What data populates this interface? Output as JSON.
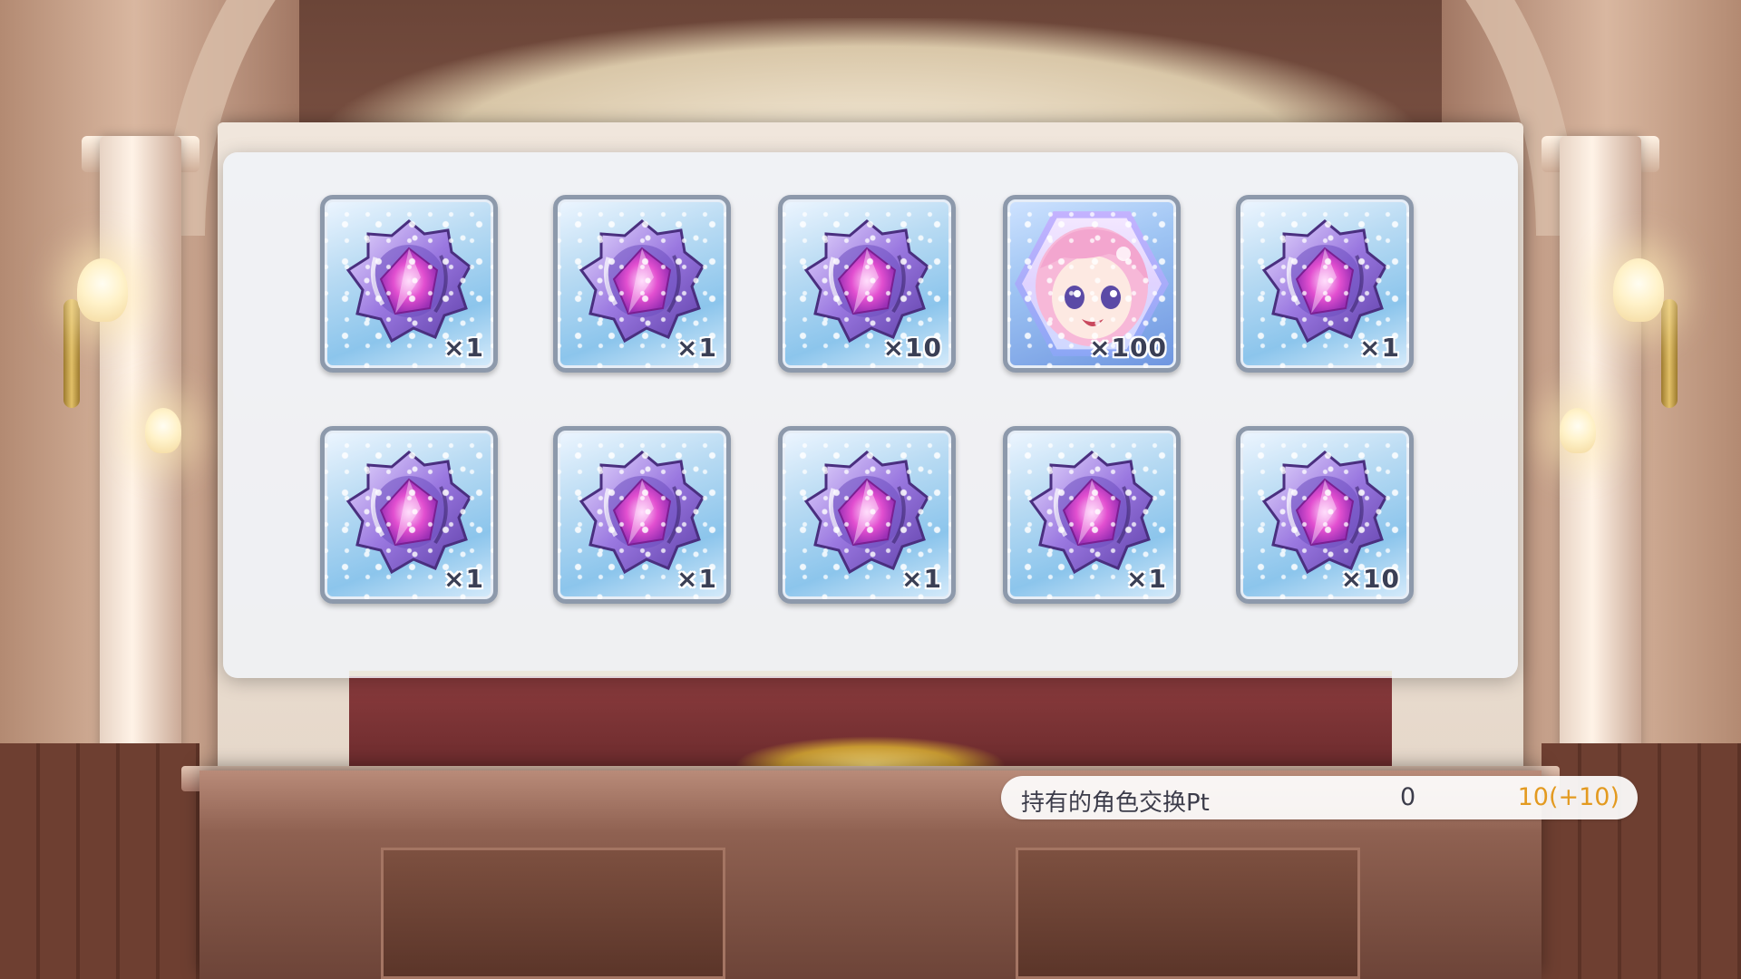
{
  "panel": {
    "items": [
      {
        "name": "crystal-fragment",
        "quantity": "×1"
      },
      {
        "name": "crystal-fragment",
        "quantity": "×1"
      },
      {
        "name": "crystal-fragment",
        "quantity": "×10"
      },
      {
        "name": "character-portrait",
        "quantity": "×100"
      },
      {
        "name": "crystal-fragment",
        "quantity": "×1"
      },
      {
        "name": "crystal-fragment",
        "quantity": "×1"
      },
      {
        "name": "crystal-fragment",
        "quantity": "×1"
      },
      {
        "name": "crystal-fragment",
        "quantity": "×1"
      },
      {
        "name": "crystal-fragment",
        "quantity": "×1"
      },
      {
        "name": "crystal-fragment",
        "quantity": "×10"
      }
    ],
    "points": {
      "label": "持有的角色交换Pt",
      "current": "0",
      "after": "10(+10)"
    }
  },
  "colors": {
    "accent_orange": "#e39a20",
    "card_border": "#8d99ab",
    "crystal_purple": "#8b4fc9",
    "crystal_core": "#e24fd0"
  }
}
